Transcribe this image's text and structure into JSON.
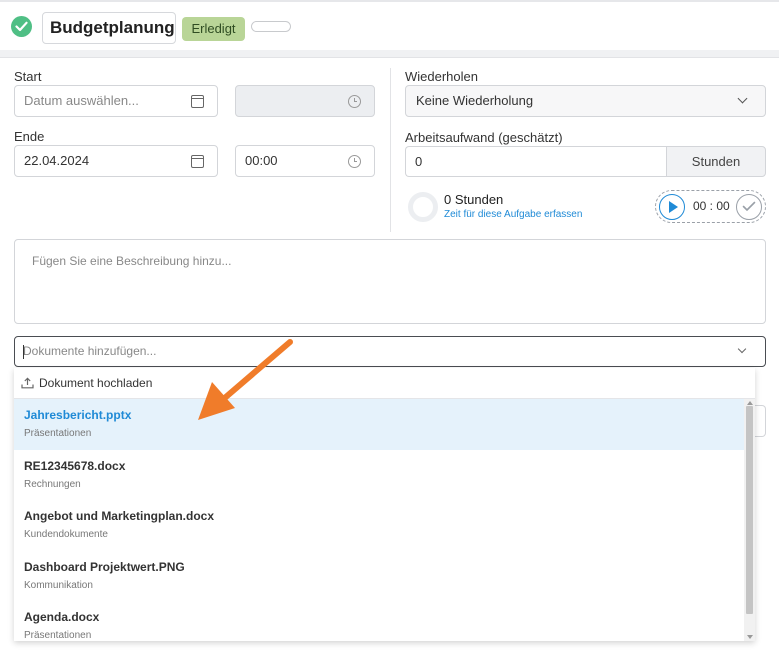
{
  "header": {
    "title": "Budgetplanung",
    "status": "Erledigt"
  },
  "schedule": {
    "start_label": "Start",
    "start_date_placeholder": "Datum auswählen...",
    "start_time": "",
    "end_label": "Ende",
    "end_date": "22.04.2024",
    "end_time": "00:00"
  },
  "repeat": {
    "label": "Wiederholen",
    "value": "Keine Wiederholung"
  },
  "effort": {
    "label": "Arbeitsaufwand (geschätzt)",
    "value": "0",
    "unit": "Stunden"
  },
  "tracking": {
    "hours": "0 Stunden",
    "link": "Zeit für diese Aufgabe erfassen",
    "timer": "00 : 00"
  },
  "description": {
    "placeholder": "Fügen Sie eine Beschreibung hinzu..."
  },
  "documents": {
    "placeholder": "Dokumente hinzufügen...",
    "upload_label": "Dokument hochladen",
    "items": [
      {
        "name": "Jahresbericht.pptx",
        "category": "Präsentationen"
      },
      {
        "name": "RE12345678.docx",
        "category": "Rechnungen"
      },
      {
        "name": "Angebot und Marketingplan.docx",
        "category": "Kundendokumente"
      },
      {
        "name": "Dashboard Projektwert.PNG",
        "category": "Kommunikation"
      },
      {
        "name": "Agenda.docx",
        "category": "Präsentationen"
      }
    ]
  },
  "colors": {
    "accent": "#1f8ad6",
    "success": "#4fbf85",
    "badge": "#b9d597",
    "arrow": "#f07c2a"
  }
}
